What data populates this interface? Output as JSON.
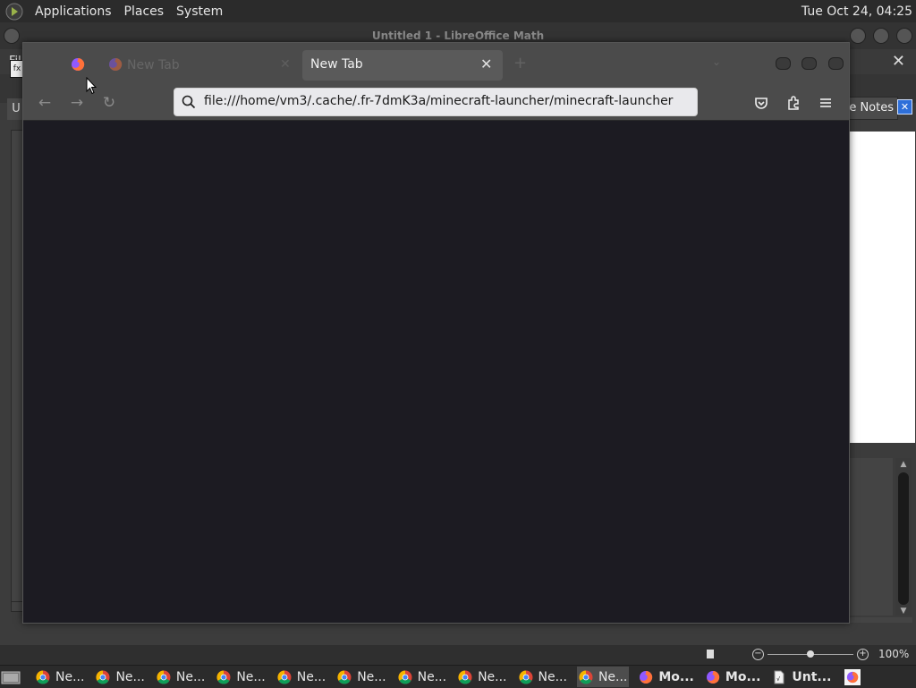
{
  "top_panel": {
    "menus": [
      "Applications",
      "Places",
      "System"
    ],
    "clock": "Tue Oct 24, 04:25"
  },
  "libreoffice": {
    "title": "Untitled 1 - LibreOffice Math",
    "menubar_text": "Fil",
    "close_glyph": "✕",
    "fx_label": "fx",
    "sidebar_tab_text": "U",
    "notes_button_label": "e Notes",
    "notes_close_glyph": "✕",
    "zoom_percent": "100%",
    "zoom_level": 0.5
  },
  "firefox": {
    "tabs": [
      {
        "label": "New Tab",
        "state": "dragging-ghost"
      },
      {
        "label": "New Tab",
        "state": "active"
      }
    ],
    "close_glyph": "✕",
    "new_tab_glyph": "+",
    "url": "file:///home/vm3/.cache/.fr-7dmK3a/minecraft-launcher/minecraft-launcher",
    "nav": {
      "back": "←",
      "forward": "→",
      "reload": "↻"
    },
    "toolbar_icons": [
      "pocket-icon",
      "extensions-icon",
      "menu-icon"
    ]
  },
  "taskbar": {
    "items": [
      {
        "label": "Ne...",
        "app": "chrome",
        "active": false,
        "bold": false
      },
      {
        "label": "Ne...",
        "app": "chrome",
        "active": false,
        "bold": false
      },
      {
        "label": "Ne...",
        "app": "chrome",
        "active": false,
        "bold": false
      },
      {
        "label": "Ne...",
        "app": "chrome",
        "active": false,
        "bold": false
      },
      {
        "label": "Ne...",
        "app": "chrome",
        "active": false,
        "bold": false
      },
      {
        "label": "Ne...",
        "app": "chrome",
        "active": false,
        "bold": false
      },
      {
        "label": "Ne...",
        "app": "chrome",
        "active": false,
        "bold": false
      },
      {
        "label": "Ne...",
        "app": "chrome",
        "active": false,
        "bold": false
      },
      {
        "label": "Ne...",
        "app": "chrome",
        "active": false,
        "bold": false
      },
      {
        "label": "Ne...",
        "app": "chrome",
        "active": true,
        "bold": false
      },
      {
        "label": "Mo...",
        "app": "firefox",
        "active": false,
        "bold": true
      },
      {
        "label": "Mo...",
        "app": "firefox",
        "active": false,
        "bold": true
      },
      {
        "label": "Unt...",
        "app": "libreoffice",
        "active": false,
        "bold": true
      }
    ]
  },
  "colors": {
    "panel_bg": "#2b2b2b",
    "firefox_content_bg": "#1c1b22",
    "urlbar_bg": "#e9e9ec",
    "chrome_red": "#db4437",
    "chrome_yellow": "#f4b400",
    "chrome_green": "#0f9d58",
    "chrome_blue": "#4285f4",
    "firefox_orange": "#ff7139",
    "firefox_purple": "#9059ff"
  }
}
